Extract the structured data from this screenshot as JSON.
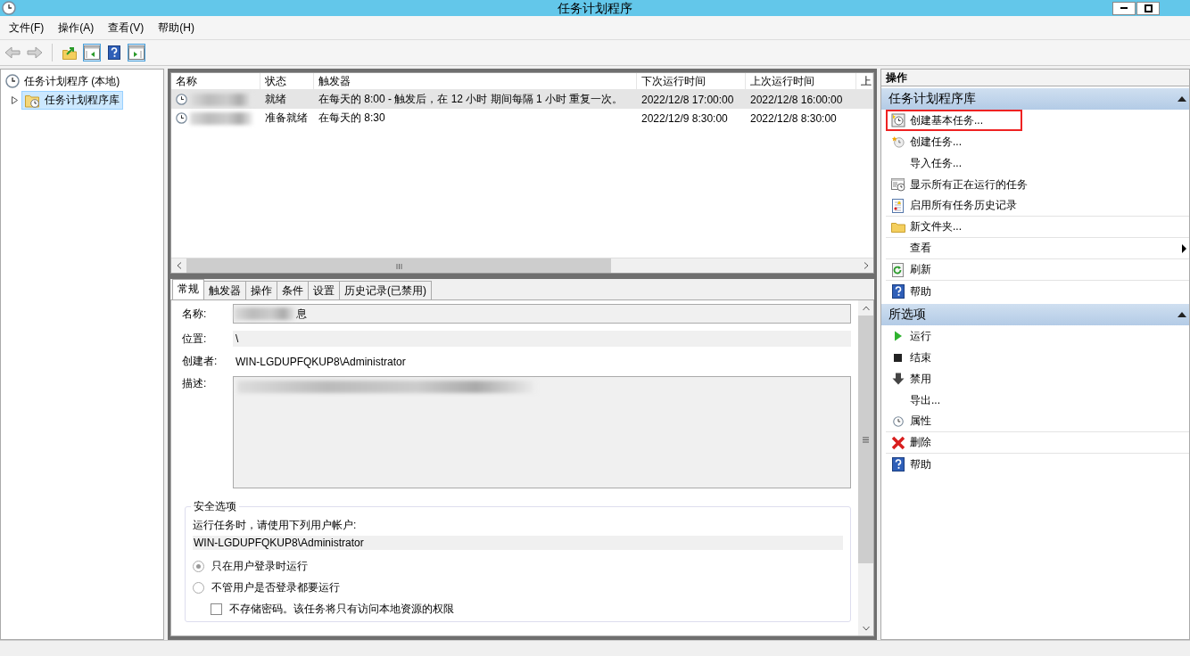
{
  "window": {
    "title": "任务计划程序"
  },
  "menu": [
    "文件(F)",
    "操作(A)",
    "查看(V)",
    "帮助(H)"
  ],
  "toolbar": [
    {
      "disabled": true,
      "pressed": false
    },
    {
      "disabled": true,
      "pressed": false
    },
    {
      "disabled": false,
      "pressed": false
    },
    {
      "disabled": false,
      "pressed": true
    },
    {
      "disabled": false,
      "pressed": false
    },
    {
      "disabled": false,
      "pressed": true
    }
  ],
  "tree": [
    {
      "label": "任务计划程序 (本地)",
      "selected": false,
      "children": [
        {
          "label": "任务计划程序库",
          "expanded": false,
          "selected": true
        }
      ]
    }
  ],
  "table": {
    "columns": [
      "名称",
      "状态",
      "触发器",
      "下次运行时间",
      "上次运行时间",
      "上"
    ],
    "rows": [
      {
        "selected": true,
        "status": "就绪",
        "trigger": "在每天的 8:00 - 触发后，在 12 小时 期间每隔 1 小时 重复一次。",
        "next_run": "2022/12/8 17:00:00",
        "last_run": "2022/12/8 16:00:00"
      },
      {
        "selected": false,
        "status": "准备就绪",
        "trigger": "在每天的 8:30",
        "next_run": "2022/12/9 8:30:00",
        "last_run": "2022/12/8 8:30:00"
      }
    ]
  },
  "tabs": [
    {
      "label": "常规",
      "selected": true
    },
    {
      "label": "触发器",
      "selected": false
    },
    {
      "label": "操作",
      "selected": false
    },
    {
      "label": "条件",
      "selected": false
    },
    {
      "label": "设置",
      "selected": false
    },
    {
      "label": "历史记录(已禁用)",
      "selected": false
    }
  ],
  "general": {
    "fields": [
      {
        "kind": "input",
        "label": "名称:",
        "value": "息"
      },
      {
        "kind": "readonly",
        "label": "位置:",
        "value": "\\"
      },
      {
        "kind": "text",
        "label": "创建者:",
        "value": "WIN-LGDUPFQKUP8\\Administrator"
      },
      {
        "kind": "textarea",
        "label": "描述:"
      }
    ],
    "security": {
      "title": "安全选项",
      "prompt": "运行任务时，请使用下列用户帐户:",
      "account": "WIN-LGDUPFQKUP8\\Administrator",
      "options": [
        {
          "label": "只在用户登录时运行",
          "selected": true
        },
        {
          "label": "不管用户是否登录都要运行",
          "selected": false
        }
      ],
      "checkbox": {
        "label": "不存储密码。该任务将只有访问本地资源的权限",
        "checked": false
      }
    }
  },
  "actions": {
    "title": "操作",
    "sections": [
      {
        "title": "任务计划程序库",
        "expanded": true,
        "groups": [
          [
            {
              "label": "创建基本任务...",
              "highlighted": true
            },
            {
              "label": "创建任务...",
              "highlighted": false
            },
            {
              "label": "导入任务...",
              "highlighted": false
            },
            {
              "label": "显示所有正在运行的任务",
              "highlighted": false
            },
            {
              "label": "启用所有任务历史记录",
              "highlighted": false
            }
          ],
          [
            {
              "label": "新文件夹...",
              "highlighted": false
            }
          ],
          [
            {
              "label": "查看",
              "highlighted": false,
              "submenu": true
            }
          ],
          [
            {
              "label": "刷新",
              "highlighted": false
            }
          ],
          [
            {
              "label": "帮助",
              "highlighted": false
            }
          ]
        ]
      },
      {
        "title": "所选项",
        "expanded": true,
        "groups": [
          [
            {
              "label": "运行",
              "highlighted": false
            },
            {
              "label": "结束",
              "highlighted": false
            },
            {
              "label": "禁用",
              "highlighted": false
            },
            {
              "label": "导出...",
              "highlighted": false
            },
            {
              "label": "属性",
              "highlighted": false
            }
          ],
          [
            {
              "label": "删除",
              "highlighted": false
            }
          ],
          [
            {
              "label": "帮助",
              "highlighted": false
            }
          ]
        ]
      }
    ]
  }
}
